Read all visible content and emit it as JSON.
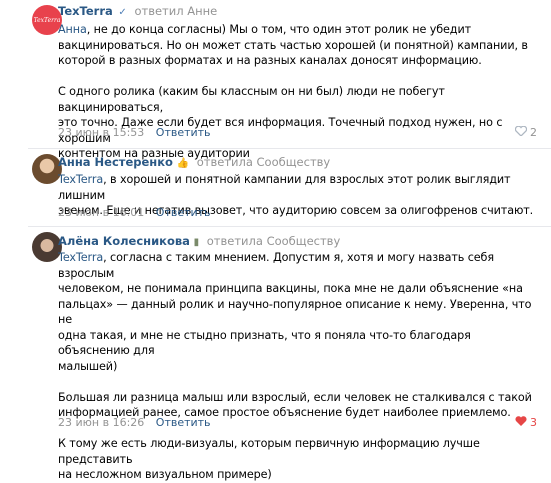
{
  "comments": [
    {
      "author": "TexTerra",
      "verified": "✓",
      "replied": "ответил Анне",
      "mention": "Анна",
      "text": ", не до конца согласны) Мы о том, что один этот ролик не убедит\nвакцинироваться. Но он может стать частью хорошей (и понятной) кампании, в\nкоторой в разных форматах и на разных каналах доносят информацию.\n\nС одного ролика (каким бы классным он ни был) люди не побегут вакцинироваться,\nэто точно. Даже если будет вся информация. Точечный подход нужен, но с хорошим\nконтентом на разные аудитории",
      "date": "23 июн в 15:53",
      "reply": "Ответить",
      "likes": "2",
      "avatar_text": "TexTerra",
      "avatar_color": "#e8424c"
    },
    {
      "author": "Анна Нестеренко",
      "badge": "👍",
      "replied": "ответила Сообществу",
      "mention": "TexTerra",
      "text": ", в хорошей и понятной кампании для взрослых этот ролик выглядит лишним\nзвеном. Еще и негатив вызовет, что аудиторию совсем за олигофренов считают.",
      "date": "23 июн в 16:01",
      "reply": "Ответить",
      "likes": ""
    },
    {
      "author": "Алёна Колесникова",
      "badge": "▮",
      "replied": "ответила Сообществу",
      "mention": "TexTerra",
      "text": ", согласна с таким мнением. Допустим я, хотя и могу назвать себя взрослым\nчеловеком, не понимала принципа вакцины, пока мне не дали объяснение «на\nпальцах» — данный ролик и научно-популярное описание к нему. Уверенна, что не\nодна такая, и мне не стыдно признать, что я поняла что-то благодаря объяснению для\nмалышей)\n\nБольшая ли разница малыш или взрослый, если человек не сталкивался с такой\nинформацией ранее, самое простое объяснение будет наиболее приемлемо.\n\nК тому же есть люди-визуалы, которым первичную информацию лучше представить\nна несложном визуальном примере)",
      "date": "23 июн в 16:26",
      "reply": "Ответить",
      "likes": "3"
    }
  ],
  "icons": {
    "like": "heart-icon",
    "liked_color": "#e64646"
  }
}
